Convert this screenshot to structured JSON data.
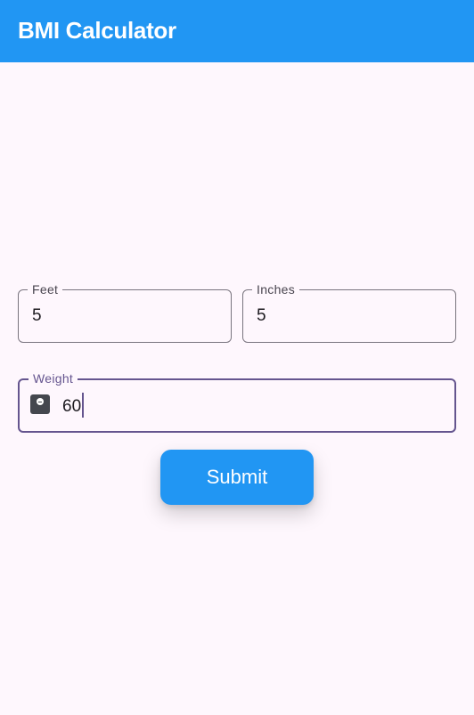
{
  "app_bar": {
    "title": "BMI Calculator",
    "color": "#2196f3"
  },
  "height": {
    "feet": {
      "label": "Feet",
      "value": "5"
    },
    "inches": {
      "label": "Inches",
      "value": "5"
    }
  },
  "weight": {
    "label": "Weight",
    "value": "60",
    "icon": "scale-icon",
    "focused": true
  },
  "submit": {
    "label": "Submit"
  },
  "colors": {
    "background": "#fef7fd",
    "accent": "#2196f3",
    "focus": "#65558f",
    "outline": "#79747e"
  }
}
